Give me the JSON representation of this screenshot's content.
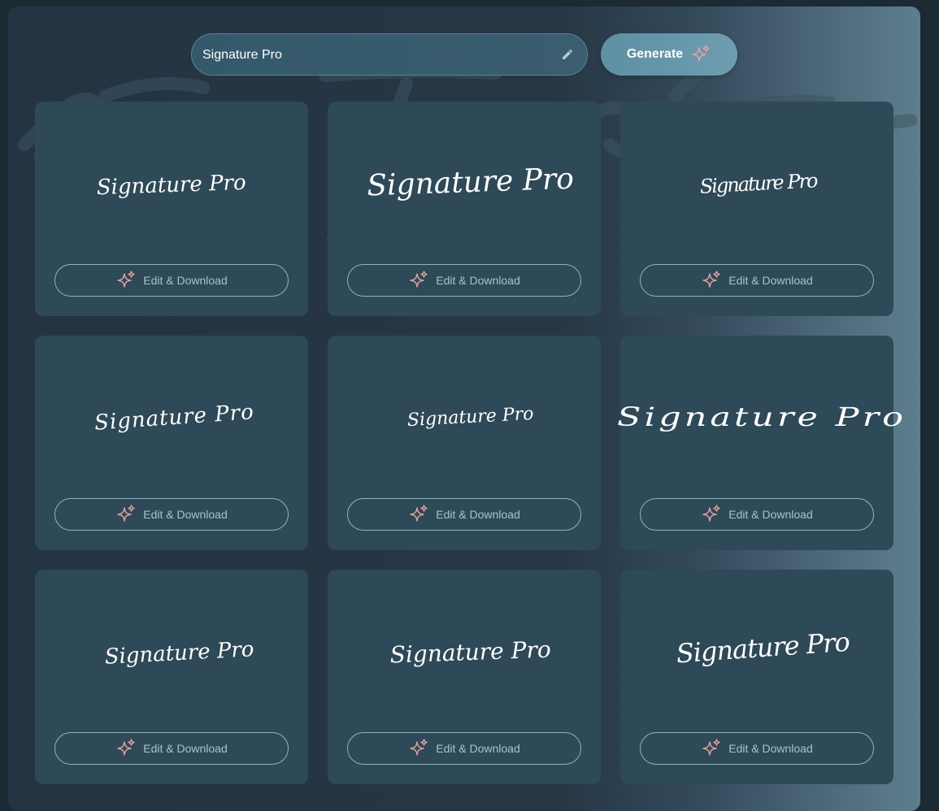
{
  "input": {
    "value": "Signature Pro",
    "edit_icon": "pencil-icon"
  },
  "generate_button": {
    "label": "Generate",
    "icon": "sparkle-icon"
  },
  "colors": {
    "background": "#1c2a34",
    "card": "#2e4957",
    "button_border": "#8fb4c2",
    "button_text": "#a3c4d1",
    "sparkle": "#e0a0a0",
    "signature_ink": "#ffffff"
  },
  "cards": [
    {
      "signature_text": "Signature Pro",
      "button_label": "Edit & Download"
    },
    {
      "signature_text": "Signature Pro",
      "button_label": "Edit & Download"
    },
    {
      "signature_text": "Signature Pro",
      "button_label": "Edit & Download"
    },
    {
      "signature_text": "Signature Pro",
      "button_label": "Edit & Download"
    },
    {
      "signature_text": "Signature Pro",
      "button_label": "Edit & Download"
    },
    {
      "signature_text": "Signature Pro",
      "button_label": "Edit & Download"
    },
    {
      "signature_text": "Signature Pro",
      "button_label": "Edit & Download"
    },
    {
      "signature_text": "Signature Pro",
      "button_label": "Edit & Download"
    },
    {
      "signature_text": "Signature Pro",
      "button_label": "Edit & Download"
    }
  ]
}
